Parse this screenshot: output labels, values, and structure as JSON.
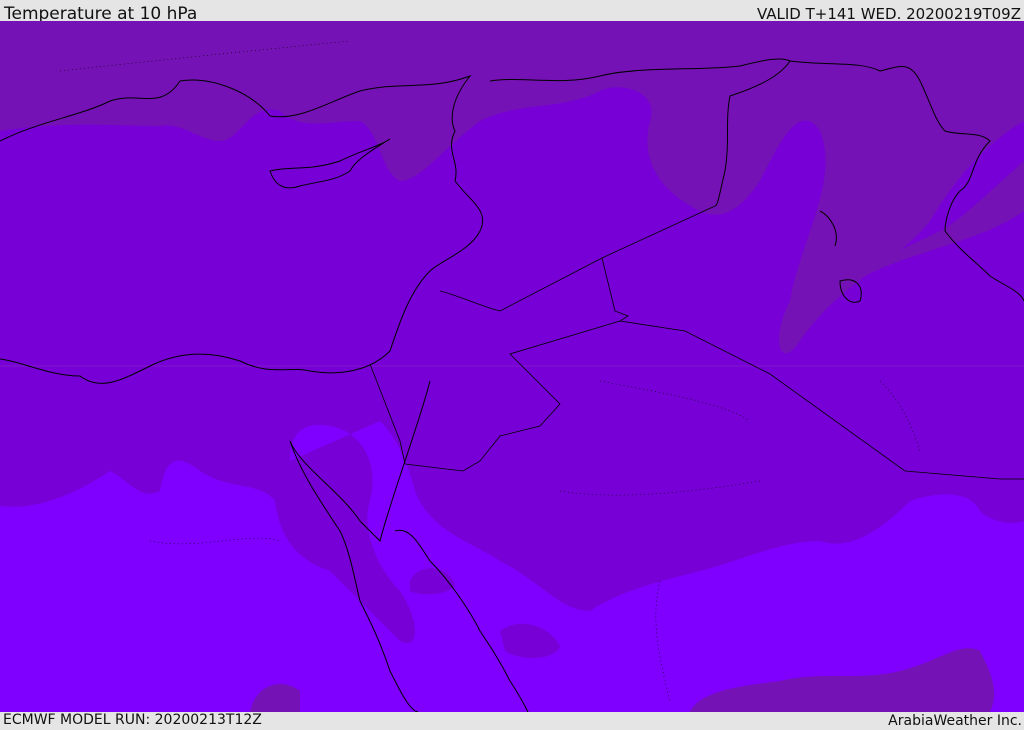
{
  "header": {
    "title": "Temperature at 10 hPa",
    "valid": "VALID T+141 WED. 20200219T09Z"
  },
  "footer": {
    "model_run": "ECMWF MODEL RUN: 20200213T12Z",
    "credit": "ArabiaWeather Inc."
  },
  "colors": {
    "cold_band": "#7512b5",
    "mid_band": "#7700d6",
    "warm_band": "#7f00ff",
    "coastline": "#000000"
  }
}
